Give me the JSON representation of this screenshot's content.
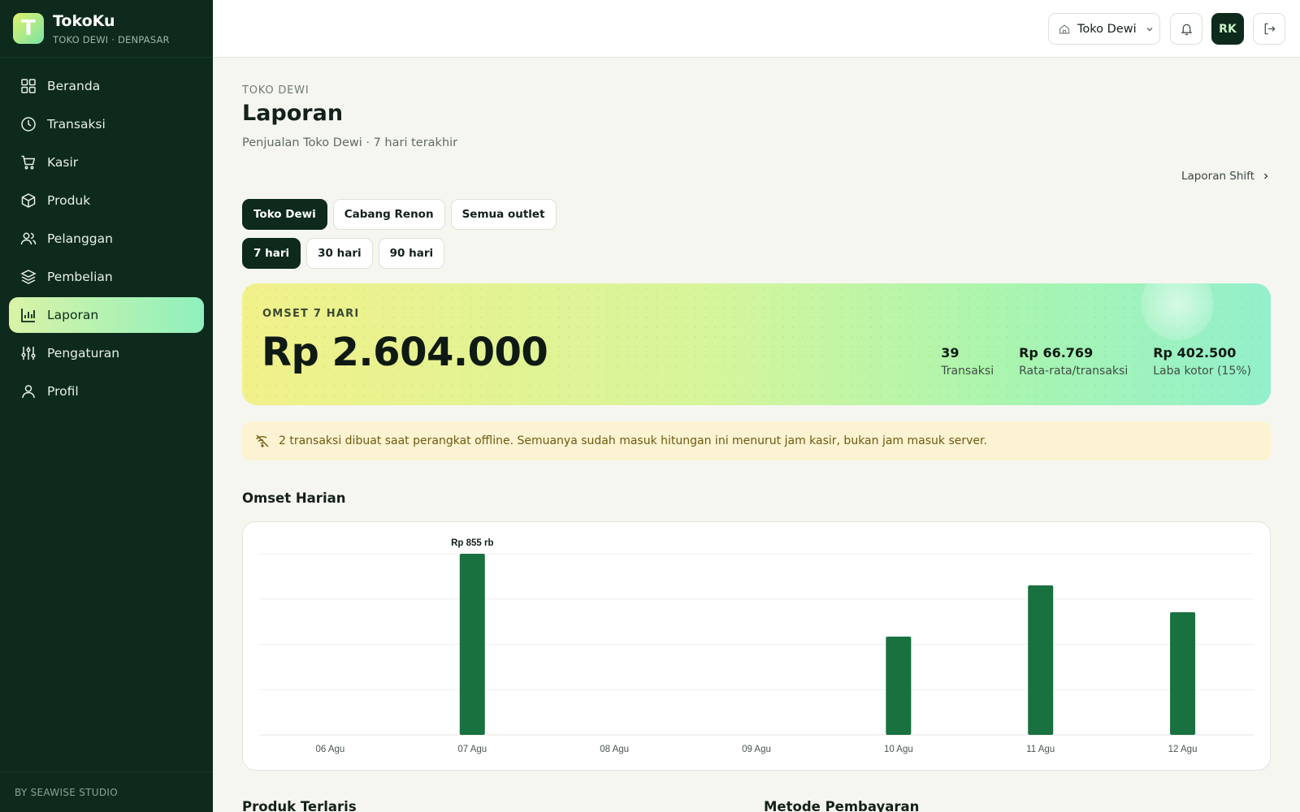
{
  "app": {
    "name": "TokoKu",
    "subtitle": "TOKO DEWI · DENPASAR",
    "logo_letter": "T"
  },
  "sidebar": {
    "items": [
      {
        "label": "Beranda",
        "icon": "grid-icon"
      },
      {
        "label": "Transaksi",
        "icon": "clock-icon"
      },
      {
        "label": "Kasir",
        "icon": "cart-icon"
      },
      {
        "label": "Produk",
        "icon": "box-icon"
      },
      {
        "label": "Pelanggan",
        "icon": "users-icon"
      },
      {
        "label": "Pembelian",
        "icon": "layers-icon"
      },
      {
        "label": "Laporan",
        "icon": "bar-chart-icon",
        "active": true
      },
      {
        "label": "Pengaturan",
        "icon": "sliders-icon"
      },
      {
        "label": "Profil",
        "icon": "user-icon"
      }
    ],
    "footer": "BY SEAWISE STUDIO"
  },
  "topbar": {
    "store": "Toko Dewi",
    "avatar": "RK"
  },
  "page": {
    "breadcrumb": "TOKO DEWI",
    "title": "Laporan",
    "subtitle": "Penjualan Toko Dewi · 7 hari terakhir",
    "shift_link": "Laporan Shift",
    "outlet_tabs": [
      "Toko Dewi",
      "Cabang Renon",
      "Semua outlet"
    ],
    "period_tabs": [
      "7 hari",
      "30 hari",
      "90 hari"
    ],
    "selected_outlet": "Toko Dewi",
    "selected_period": "7 hari"
  },
  "summary": {
    "label": "OMSET 7 HARI",
    "value": "Rp 2.604.000",
    "stats": [
      {
        "value": "39",
        "label": "Transaksi"
      },
      {
        "value": "Rp 66.769",
        "label": "Rata-rata/transaksi"
      },
      {
        "value": "Rp 402.500",
        "label": "Laba kotor (15%)"
      }
    ]
  },
  "notice": "2 transaksi dibuat saat perangkat offline. Semuanya sudah masuk hitungan ini menurut jam kasir, bukan jam masuk server.",
  "sections": {
    "daily": "Omset Harian",
    "top_products": "Produk Terlaris",
    "payment_methods": "Metode Pembayaran"
  },
  "colors": {
    "brand_dark": "#0d2a1c",
    "bar": "#18713f",
    "accent_lime": "#dff26a",
    "accent_mint": "#93f0cc",
    "notice_bg": "#fbf3d2"
  },
  "chart_data": {
    "type": "bar",
    "categories": [
      "06 Agu",
      "07 Agu",
      "08 Agu",
      "09 Agu",
      "10 Agu",
      "11 Agu",
      "12 Agu"
    ],
    "values": [
      0,
      855,
      0,
      0,
      464,
      706,
      579
    ],
    "unit": "rb",
    "ylim": [
      0,
      855
    ],
    "max_label": "Rp 855 rb",
    "grid": true
  }
}
